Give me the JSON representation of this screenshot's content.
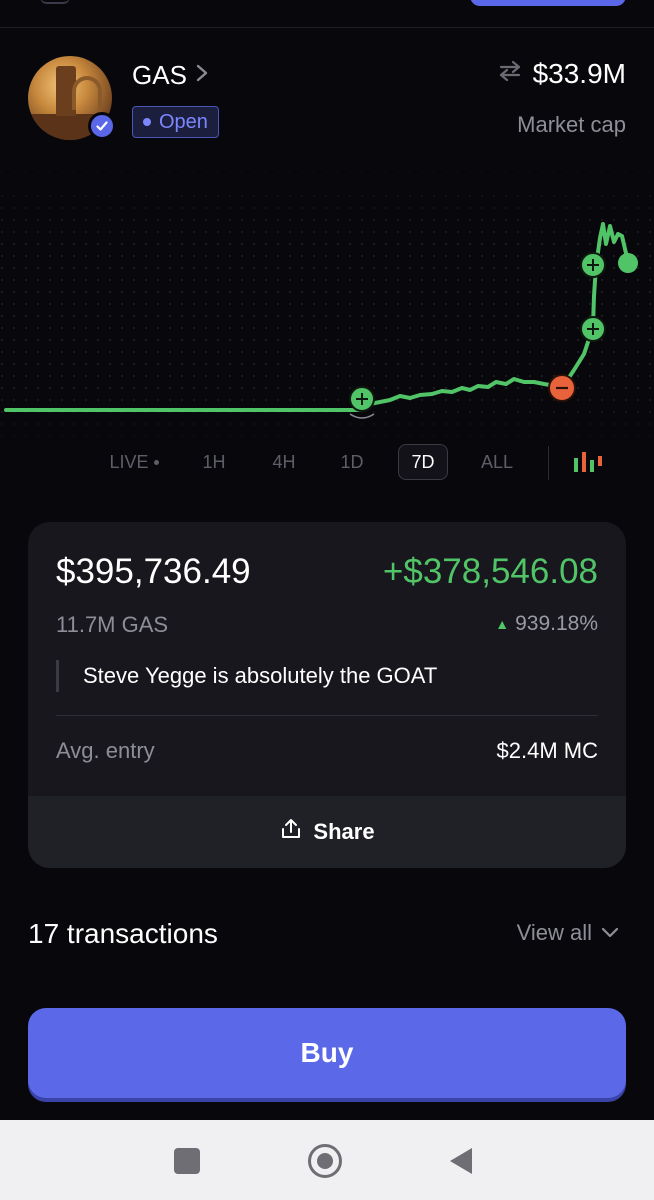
{
  "token": {
    "name": "GAS",
    "status": "Open",
    "market_cap_value": "$33.9M",
    "market_cap_label": "Market cap"
  },
  "timeframes": [
    {
      "label": "LIVE",
      "active": false
    },
    {
      "label": "1H",
      "active": false
    },
    {
      "label": "4H",
      "active": false
    },
    {
      "label": "1D",
      "active": false
    },
    {
      "label": "7D",
      "active": true
    },
    {
      "label": "ALL",
      "active": false
    }
  ],
  "position": {
    "value": "$395,736.49",
    "pnl": "+$378,546.08",
    "amount": "11.7M GAS",
    "pnl_percent": "939.18%",
    "note": "Steve Yegge is absolutely the GOAT",
    "avg_entry_label": "Avg. entry",
    "avg_entry_value": "$2.4M MC",
    "share_label": "Share"
  },
  "transactions": {
    "count_label": "17 transactions",
    "view_all_label": "View all"
  },
  "buy_label": "Buy",
  "colors": {
    "accent": "#5b69e9",
    "up": "#52c468",
    "down": "#e8623c",
    "background": "#08080c"
  },
  "icons": [
    "chevron-right-icon",
    "swap-icon",
    "verified-icon",
    "share-icon",
    "chevron-down-icon",
    "candlestick-icon",
    "nav-square-icon",
    "nav-home-icon",
    "nav-back-icon"
  ]
}
